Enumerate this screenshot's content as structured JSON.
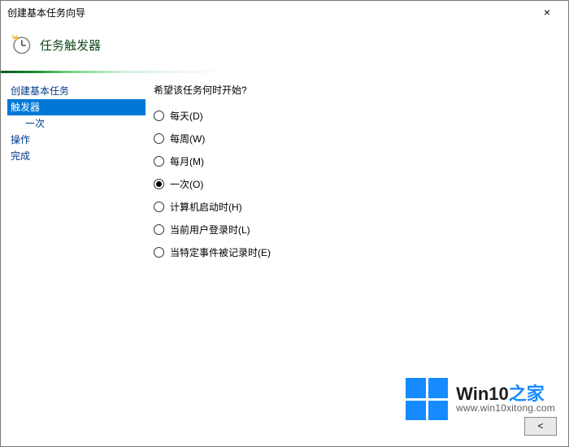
{
  "window": {
    "title": "创建基本任务向导",
    "close_label": "×"
  },
  "header": {
    "heading": "任务触发器"
  },
  "sidebar": {
    "items": [
      {
        "label": "创建基本任务",
        "selected": false,
        "indent": 0
      },
      {
        "label": "触发器",
        "selected": true,
        "indent": 0
      },
      {
        "label": "一次",
        "selected": false,
        "indent": 1
      },
      {
        "label": "操作",
        "selected": false,
        "indent": 0
      },
      {
        "label": "完成",
        "selected": false,
        "indent": 0
      }
    ]
  },
  "content": {
    "prompt": "希望该任务何时开始?",
    "options": [
      {
        "label": "每天(D)",
        "checked": false
      },
      {
        "label": "每周(W)",
        "checked": false
      },
      {
        "label": "每月(M)",
        "checked": false
      },
      {
        "label": "一次(O)",
        "checked": true
      },
      {
        "label": "计算机启动时(H)",
        "checked": false
      },
      {
        "label": "当前用户登录时(L)",
        "checked": false
      },
      {
        "label": "当特定事件被记录时(E)",
        "checked": false
      }
    ]
  },
  "buttons": {
    "back": "< "
  },
  "watermark": {
    "title_pre": "Win10",
    "title_suf": "之家",
    "url": "www.win10xitong.com"
  }
}
